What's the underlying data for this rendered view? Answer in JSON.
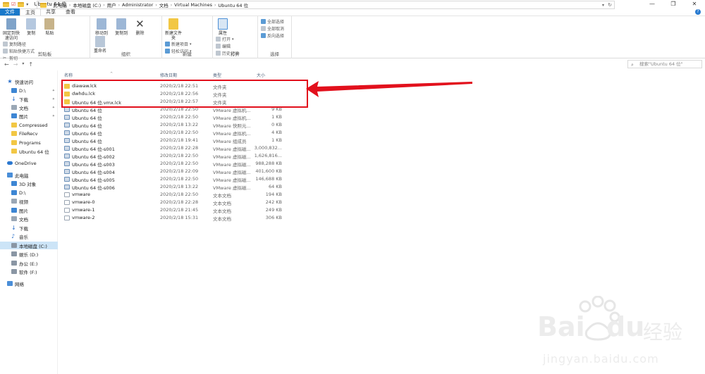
{
  "window": {
    "title": "Ubuntu 64 位",
    "min_label": "—",
    "max_label": "❐",
    "close_label": "✕"
  },
  "ribbon_tabs": {
    "file": "文件",
    "home": "主页",
    "share": "共享",
    "view": "查看"
  },
  "ribbon": {
    "clipboard": {
      "pin": "固定到快速访问",
      "copy": "复制",
      "paste": "粘贴",
      "copy_path": "复制路径",
      "paste_shortcut": "粘贴快捷方式",
      "cut": "剪切",
      "label": "剪贴板"
    },
    "organize": {
      "move_to": "移动到",
      "copy_to": "复制到",
      "delete": "删除",
      "rename": "重命名",
      "label": "组织"
    },
    "new": {
      "new_folder": "新建文件夹",
      "new_item": "新建项目",
      "easy_access": "轻松访问",
      "label": "新建"
    },
    "open": {
      "properties": "属性",
      "open": "打开",
      "edit": "编辑",
      "history": "历史记录",
      "label": "打开"
    },
    "select": {
      "select_all": "全部选择",
      "select_none": "全部取消",
      "invert": "反向选择",
      "label": "选择"
    }
  },
  "address": {
    "crumbs": [
      "此电脑",
      "本地磁盘 (C:)",
      "用户",
      "Administrator",
      "文档",
      "Virtual Machines",
      "Ubuntu 64 位"
    ],
    "search_placeholder": "搜索\"Ubuntu 64 位\""
  },
  "sidebar": {
    "items": [
      {
        "label": "快速访问",
        "icon": "star-icon"
      },
      {
        "label": "D:\\",
        "icon": "drive-icon"
      },
      {
        "label": "下载",
        "icon": "download-icon"
      },
      {
        "label": "文档",
        "icon": "documents-icon"
      },
      {
        "label": "图片",
        "icon": "pictures-icon"
      },
      {
        "label": "Compressed",
        "icon": "folder-icon"
      },
      {
        "label": "FileRecv",
        "icon": "folder-icon"
      },
      {
        "label": "Programs",
        "icon": "folder-icon"
      },
      {
        "label": "Ubuntu 64 位",
        "icon": "folder-icon"
      },
      {
        "label": "OneDrive",
        "icon": "cloud-icon"
      },
      {
        "label": "此电脑",
        "icon": "pc-icon"
      },
      {
        "label": "3D 对象",
        "icon": "cube-icon"
      },
      {
        "label": "D:\\",
        "icon": "drive-icon"
      },
      {
        "label": "视频",
        "icon": "video-icon"
      },
      {
        "label": "图片",
        "icon": "pictures-icon"
      },
      {
        "label": "文档",
        "icon": "documents-icon"
      },
      {
        "label": "下载",
        "icon": "download-icon"
      },
      {
        "label": "音乐",
        "icon": "music-icon"
      },
      {
        "label": "本地磁盘 (C:)",
        "icon": "drive-icon"
      },
      {
        "label": "娱乐 (D:)",
        "icon": "drive-icon"
      },
      {
        "label": "办公 (E:)",
        "icon": "drive-icon"
      },
      {
        "label": "软件 (F:)",
        "icon": "drive-icon"
      },
      {
        "label": "网络",
        "icon": "network-icon"
      }
    ]
  },
  "columns": {
    "name": "名称",
    "date": "修改日期",
    "type": "类型",
    "size": "大小"
  },
  "files": [
    {
      "name": "diawaw.lck",
      "date": "2020/2/18 22:51",
      "type": "文件夹",
      "size": "",
      "kind": "folder"
    },
    {
      "name": "dwhdu.lck",
      "date": "2020/2/18 22:56",
      "type": "文件夹",
      "size": "",
      "kind": "folder"
    },
    {
      "name": "Ubuntu 64 位.vmx.lck",
      "date": "2020/2/18 22:57",
      "type": "文件夹",
      "size": "",
      "kind": "folder"
    },
    {
      "name": "Ubuntu 64 位",
      "date": "2020/2/18 22:50",
      "type": "VMware 虚拟机...",
      "size": "9 KB",
      "kind": "vm"
    },
    {
      "name": "Ubuntu 64 位",
      "date": "2020/2/18 22:50",
      "type": "VMware 虚拟机...",
      "size": "1 KB",
      "kind": "vm"
    },
    {
      "name": "Ubuntu 64 位",
      "date": "2020/2/18 13:22",
      "type": "VMware 快照元...",
      "size": "0 KB",
      "kind": "vm"
    },
    {
      "name": "Ubuntu 64 位",
      "date": "2020/2/18 22:50",
      "type": "VMware 虚拟机...",
      "size": "4 KB",
      "kind": "vm"
    },
    {
      "name": "Ubuntu 64 位",
      "date": "2020/2/18 19:41",
      "type": "VMware 组成员",
      "size": "1 KB",
      "kind": "vm"
    },
    {
      "name": "Ubuntu 64 位-s001",
      "date": "2020/2/18 22:28",
      "type": "VMware 虚拟磁...",
      "size": "3,000,832...",
      "kind": "vm"
    },
    {
      "name": "Ubuntu 64 位-s002",
      "date": "2020/2/18 22:50",
      "type": "VMware 虚拟磁...",
      "size": "1,626,816...",
      "kind": "vm"
    },
    {
      "name": "Ubuntu 64 位-s003",
      "date": "2020/2/18 22:50",
      "type": "VMware 虚拟磁...",
      "size": "988,288 KB",
      "kind": "vm"
    },
    {
      "name": "Ubuntu 64 位-s004",
      "date": "2020/2/18 22:09",
      "type": "VMware 虚拟磁...",
      "size": "401,600 KB",
      "kind": "vm"
    },
    {
      "name": "Ubuntu 64 位-s005",
      "date": "2020/2/18 22:50",
      "type": "VMware 虚拟磁...",
      "size": "146,688 KB",
      "kind": "vm"
    },
    {
      "name": "Ubuntu 64 位-s006",
      "date": "2020/2/18 13:22",
      "type": "VMware 虚拟磁...",
      "size": "64 KB",
      "kind": "vm"
    },
    {
      "name": "vmware",
      "date": "2020/2/18 22:50",
      "type": "文本文档",
      "size": "194 KB",
      "kind": "txt"
    },
    {
      "name": "vmware-0",
      "date": "2020/2/18 22:28",
      "type": "文本文档",
      "size": "242 KB",
      "kind": "txt"
    },
    {
      "name": "vmware-1",
      "date": "2020/2/18 21:45",
      "type": "文本文档",
      "size": "249 KB",
      "kind": "txt"
    },
    {
      "name": "vmware-2",
      "date": "2020/2/18 15:31",
      "type": "文本文档",
      "size": "306 KB",
      "kind": "txt"
    }
  ],
  "watermark": {
    "brand": "Bai",
    "brand2": "du",
    "cn": "经验",
    "url": "jingyan.baidu.com"
  },
  "colors": {
    "accent": "#1979ca",
    "highlight": "#e2101c",
    "folder": "#f2c744",
    "selection": "#cce4f7"
  }
}
